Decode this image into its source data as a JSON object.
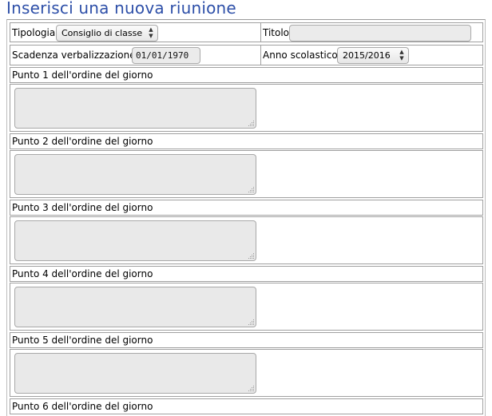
{
  "page": {
    "title": "Inserisci una nuova riunione"
  },
  "form": {
    "tipologia": {
      "label": "Tipologia",
      "selected": "Consiglio di classe"
    },
    "titolo": {
      "label": "Titolo",
      "value": ""
    },
    "scadenza": {
      "label": "Scadenza verbalizzazione",
      "value": "01/01/1970"
    },
    "anno": {
      "label": "Anno scolastico",
      "selected": "2015/2016"
    },
    "punti": [
      {
        "label": "Punto 1 dell'ordine del giorno",
        "value": ""
      },
      {
        "label": "Punto 2 dell'ordine del giorno",
        "value": ""
      },
      {
        "label": "Punto 3 dell'ordine del giorno",
        "value": ""
      },
      {
        "label": "Punto 4 dell'ordine del giorno",
        "value": ""
      },
      {
        "label": "Punto 5 dell'ordine del giorno",
        "value": ""
      },
      {
        "label": "Punto 6 dell'ordine del giorno",
        "value": ""
      }
    ]
  },
  "icons": {
    "select_arrows": "up-down-arrows-icon",
    "resize_grip": "resize-grip-icon"
  },
  "colors": {
    "title": "#2d4fa8",
    "field_background": "#ebebeb",
    "border": "#a0a0a0"
  }
}
